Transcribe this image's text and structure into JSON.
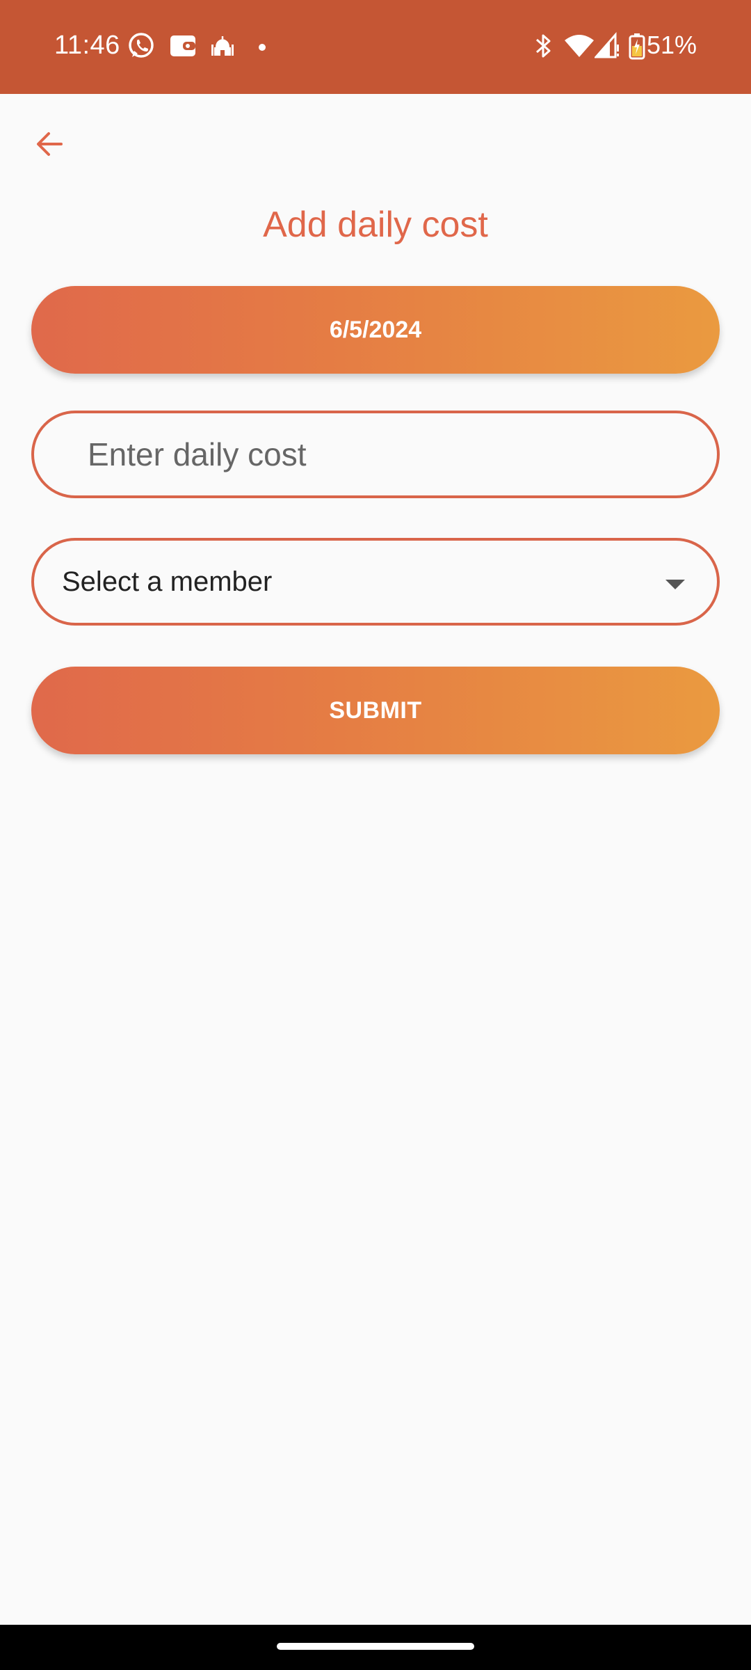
{
  "status_bar": {
    "time": "11:46",
    "battery": "51%",
    "background": "#c55634",
    "left_icons": [
      "whatsapp-icon",
      "wallet-icon",
      "mosque-icon",
      "dot-icon"
    ],
    "right_icons": [
      "bluetooth-icon",
      "wifi-icon",
      "signal-icon",
      "battery-charging-icon"
    ]
  },
  "header": {
    "back_icon": "arrow-back-icon",
    "title": "Add daily cost"
  },
  "form": {
    "date_label": "6/5/2024",
    "cost_placeholder": "Enter daily cost",
    "cost_value": "",
    "member_select_label": "Select a member",
    "submit_label": "SUBMIT"
  },
  "colors": {
    "accent": "#e0674a",
    "gradient_start": "#e0694b",
    "gradient_end": "#ea9a40",
    "border": "#d9654a"
  }
}
